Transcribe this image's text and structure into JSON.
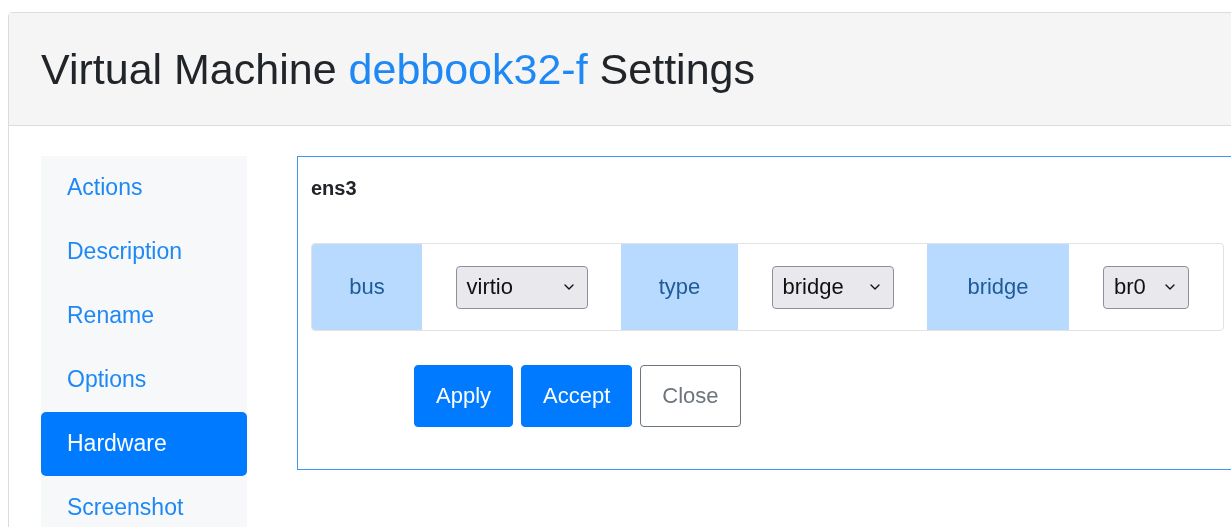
{
  "header": {
    "title_prefix": "Virtual Machine",
    "vm_name": "debbook32-f",
    "title_suffix": "Settings"
  },
  "sidebar": {
    "items": [
      {
        "label": "Actions",
        "selected": false
      },
      {
        "label": "Description",
        "selected": false
      },
      {
        "label": "Rename",
        "selected": false
      },
      {
        "label": "Options",
        "selected": false
      },
      {
        "label": "Hardware",
        "selected": true
      },
      {
        "label": "Screenshot",
        "selected": false
      }
    ]
  },
  "panel": {
    "title": "ens3",
    "fields": [
      {
        "label": "bus",
        "value": "virtio"
      },
      {
        "label": "type",
        "value": "bridge"
      },
      {
        "label": "bridge",
        "value": "br0"
      }
    ],
    "buttons": [
      {
        "label": "Apply",
        "kind": "primary"
      },
      {
        "label": "Accept",
        "kind": "primary"
      },
      {
        "label": "Close",
        "kind": "outline"
      }
    ]
  }
}
